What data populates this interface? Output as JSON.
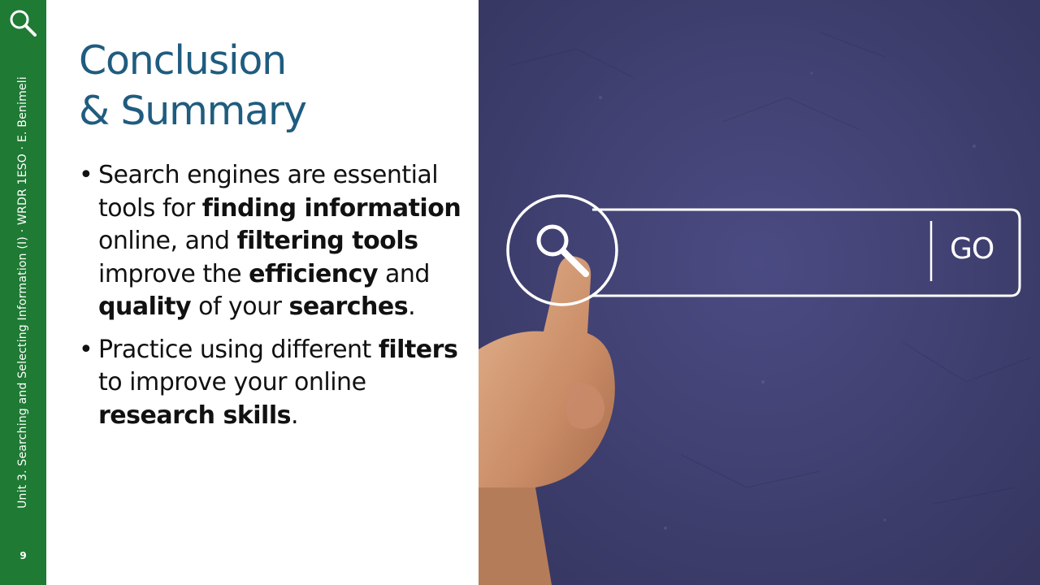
{
  "sidebar": {
    "caption": "Unit 3. Searching and Selecting Information (I) · WRDR 1ESO · E. Benimeli",
    "page_number": "9",
    "icon": "search-icon",
    "color": "#1f7a34"
  },
  "title": {
    "line1": "Conclusion",
    "line2": "& Summary",
    "color": "#1f5c7f"
  },
  "bullets": [
    {
      "parts": [
        {
          "t": "Search engines are essential tools for ",
          "b": false
        },
        {
          "t": "finding information",
          "b": true
        },
        {
          "t": " online, and ",
          "b": false
        },
        {
          "t": "filtering tools",
          "b": true
        },
        {
          "t": " improve the ",
          "b": false
        },
        {
          "t": "efficiency",
          "b": true
        },
        {
          "t": " and ",
          "b": false
        },
        {
          "t": "quality",
          "b": true
        },
        {
          "t": " of your ",
          "b": false
        },
        {
          "t": "searches",
          "b": true
        },
        {
          "t": ".",
          "b": false
        }
      ]
    },
    {
      "parts": [
        {
          "t": "Practice using different ",
          "b": false
        },
        {
          "t": "filters",
          "b": true
        },
        {
          "t": " to improve your online ",
          "b": false
        },
        {
          "t": "research skills",
          "b": true
        },
        {
          "t": ".",
          "b": false
        }
      ]
    }
  ],
  "photo": {
    "search_bar_button": "GO",
    "icon": "magnifier-icon",
    "background_color": "#434378"
  }
}
